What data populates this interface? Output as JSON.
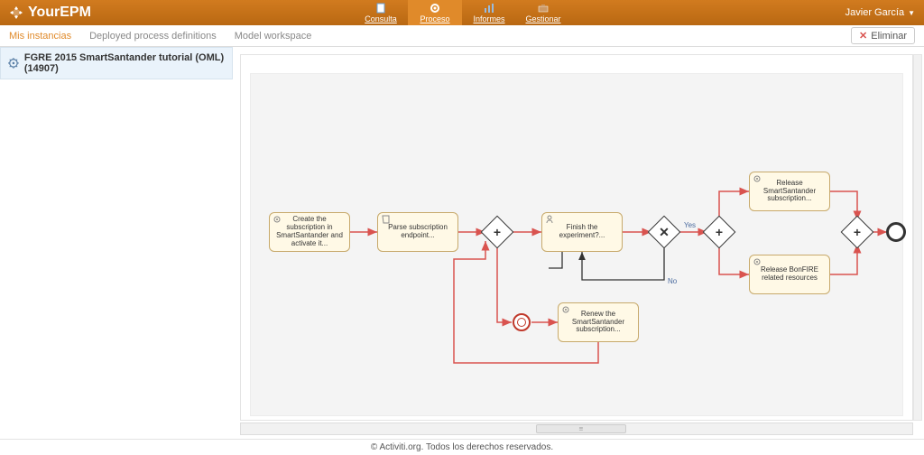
{
  "brand": "YourEPM",
  "user": "Javier García",
  "topnav": [
    {
      "label": "Consulta",
      "icon": "doc"
    },
    {
      "label": "Proceso",
      "icon": "cog",
      "active": true
    },
    {
      "label": "Informes",
      "icon": "chart"
    },
    {
      "label": "Gestionar",
      "icon": "briefcase"
    }
  ],
  "subtabs": [
    {
      "label": "Mis instancias",
      "active": true
    },
    {
      "label": "Deployed process definitions"
    },
    {
      "label": "Model workspace"
    }
  ],
  "delete_label": "Eliminar",
  "instance": {
    "label": "FGRE 2015 SmartSantander tutorial (OML) (14907)"
  },
  "tasks": {
    "create": "Create the subscription in SmartSantander and activate it...",
    "parse": "Parse subscription endpoint...",
    "finish": "Finish the experiment?...",
    "renew": "Renew the SmartSantander subscription...",
    "release_ss": "Release SmartSantander subscription...",
    "release_bf": "Release BonFIRE related resources"
  },
  "flow_labels": {
    "yes": "Yes",
    "no": "No"
  },
  "footer": "© Activiti.org. Todos los derechos reservados."
}
